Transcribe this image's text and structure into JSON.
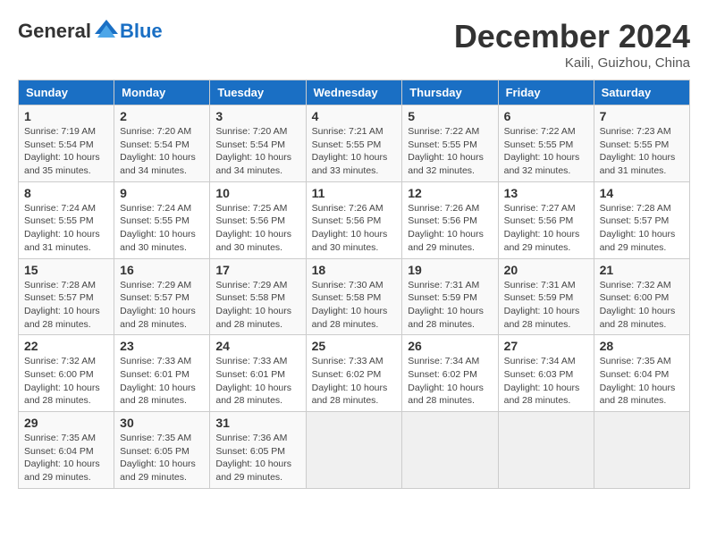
{
  "header": {
    "logo_general": "General",
    "logo_blue": "Blue",
    "month_title": "December 2024",
    "location": "Kaili, Guizhou, China"
  },
  "days_of_week": [
    "Sunday",
    "Monday",
    "Tuesday",
    "Wednesday",
    "Thursday",
    "Friday",
    "Saturday"
  ],
  "weeks": [
    [
      {
        "day": "1",
        "info": "Sunrise: 7:19 AM\nSunset: 5:54 PM\nDaylight: 10 hours\nand 35 minutes."
      },
      {
        "day": "2",
        "info": "Sunrise: 7:20 AM\nSunset: 5:54 PM\nDaylight: 10 hours\nand 34 minutes."
      },
      {
        "day": "3",
        "info": "Sunrise: 7:20 AM\nSunset: 5:54 PM\nDaylight: 10 hours\nand 34 minutes."
      },
      {
        "day": "4",
        "info": "Sunrise: 7:21 AM\nSunset: 5:55 PM\nDaylight: 10 hours\nand 33 minutes."
      },
      {
        "day": "5",
        "info": "Sunrise: 7:22 AM\nSunset: 5:55 PM\nDaylight: 10 hours\nand 32 minutes."
      },
      {
        "day": "6",
        "info": "Sunrise: 7:22 AM\nSunset: 5:55 PM\nDaylight: 10 hours\nand 32 minutes."
      },
      {
        "day": "7",
        "info": "Sunrise: 7:23 AM\nSunset: 5:55 PM\nDaylight: 10 hours\nand 31 minutes."
      }
    ],
    [
      {
        "day": "8",
        "info": "Sunrise: 7:24 AM\nSunset: 5:55 PM\nDaylight: 10 hours\nand 31 minutes."
      },
      {
        "day": "9",
        "info": "Sunrise: 7:24 AM\nSunset: 5:55 PM\nDaylight: 10 hours\nand 30 minutes."
      },
      {
        "day": "10",
        "info": "Sunrise: 7:25 AM\nSunset: 5:56 PM\nDaylight: 10 hours\nand 30 minutes."
      },
      {
        "day": "11",
        "info": "Sunrise: 7:26 AM\nSunset: 5:56 PM\nDaylight: 10 hours\nand 30 minutes."
      },
      {
        "day": "12",
        "info": "Sunrise: 7:26 AM\nSunset: 5:56 PM\nDaylight: 10 hours\nand 29 minutes."
      },
      {
        "day": "13",
        "info": "Sunrise: 7:27 AM\nSunset: 5:56 PM\nDaylight: 10 hours\nand 29 minutes."
      },
      {
        "day": "14",
        "info": "Sunrise: 7:28 AM\nSunset: 5:57 PM\nDaylight: 10 hours\nand 29 minutes."
      }
    ],
    [
      {
        "day": "15",
        "info": "Sunrise: 7:28 AM\nSunset: 5:57 PM\nDaylight: 10 hours\nand 28 minutes."
      },
      {
        "day": "16",
        "info": "Sunrise: 7:29 AM\nSunset: 5:57 PM\nDaylight: 10 hours\nand 28 minutes."
      },
      {
        "day": "17",
        "info": "Sunrise: 7:29 AM\nSunset: 5:58 PM\nDaylight: 10 hours\nand 28 minutes."
      },
      {
        "day": "18",
        "info": "Sunrise: 7:30 AM\nSunset: 5:58 PM\nDaylight: 10 hours\nand 28 minutes."
      },
      {
        "day": "19",
        "info": "Sunrise: 7:31 AM\nSunset: 5:59 PM\nDaylight: 10 hours\nand 28 minutes."
      },
      {
        "day": "20",
        "info": "Sunrise: 7:31 AM\nSunset: 5:59 PM\nDaylight: 10 hours\nand 28 minutes."
      },
      {
        "day": "21",
        "info": "Sunrise: 7:32 AM\nSunset: 6:00 PM\nDaylight: 10 hours\nand 28 minutes."
      }
    ],
    [
      {
        "day": "22",
        "info": "Sunrise: 7:32 AM\nSunset: 6:00 PM\nDaylight: 10 hours\nand 28 minutes."
      },
      {
        "day": "23",
        "info": "Sunrise: 7:33 AM\nSunset: 6:01 PM\nDaylight: 10 hours\nand 28 minutes."
      },
      {
        "day": "24",
        "info": "Sunrise: 7:33 AM\nSunset: 6:01 PM\nDaylight: 10 hours\nand 28 minutes."
      },
      {
        "day": "25",
        "info": "Sunrise: 7:33 AM\nSunset: 6:02 PM\nDaylight: 10 hours\nand 28 minutes."
      },
      {
        "day": "26",
        "info": "Sunrise: 7:34 AM\nSunset: 6:02 PM\nDaylight: 10 hours\nand 28 minutes."
      },
      {
        "day": "27",
        "info": "Sunrise: 7:34 AM\nSunset: 6:03 PM\nDaylight: 10 hours\nand 28 minutes."
      },
      {
        "day": "28",
        "info": "Sunrise: 7:35 AM\nSunset: 6:04 PM\nDaylight: 10 hours\nand 28 minutes."
      }
    ],
    [
      {
        "day": "29",
        "info": "Sunrise: 7:35 AM\nSunset: 6:04 PM\nDaylight: 10 hours\nand 29 minutes."
      },
      {
        "day": "30",
        "info": "Sunrise: 7:35 AM\nSunset: 6:05 PM\nDaylight: 10 hours\nand 29 minutes."
      },
      {
        "day": "31",
        "info": "Sunrise: 7:36 AM\nSunset: 6:05 PM\nDaylight: 10 hours\nand 29 minutes."
      },
      {
        "day": "",
        "info": ""
      },
      {
        "day": "",
        "info": ""
      },
      {
        "day": "",
        "info": ""
      },
      {
        "day": "",
        "info": ""
      }
    ]
  ]
}
